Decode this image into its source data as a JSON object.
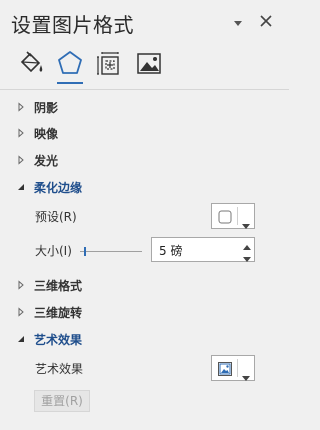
{
  "panel": {
    "title": "设置图片格式"
  },
  "tabs": [
    {
      "name": "填充与线条",
      "icon": "paint-bucket-icon"
    },
    {
      "name": "效果",
      "icon": "pentagon-icon",
      "selected": true
    },
    {
      "name": "大小与属性",
      "icon": "size-properties-icon"
    },
    {
      "name": "图片",
      "icon": "picture-icon"
    }
  ],
  "sections": {
    "shadow": {
      "label": "阴影",
      "expanded": false
    },
    "reflection": {
      "label": "映像",
      "expanded": false
    },
    "glow": {
      "label": "发光",
      "expanded": false
    },
    "soft_edges": {
      "label": "柔化边缘",
      "expanded": true
    },
    "format_3d": {
      "label": "三维格式",
      "expanded": false
    },
    "rotation_3d": {
      "label": "三维旋转",
      "expanded": false
    },
    "artistic": {
      "label": "艺术效果",
      "expanded": true
    }
  },
  "soft_edges": {
    "preset_label": "预设(R)",
    "size_label": "大小(I)",
    "size_value": "5 磅"
  },
  "artistic": {
    "effects_label": "艺术效果",
    "reset_label": "重置(R)"
  },
  "colors": {
    "accent": "#2f6db5",
    "background": "#f0f0f0",
    "section_expanded": "#1f4e8c"
  }
}
